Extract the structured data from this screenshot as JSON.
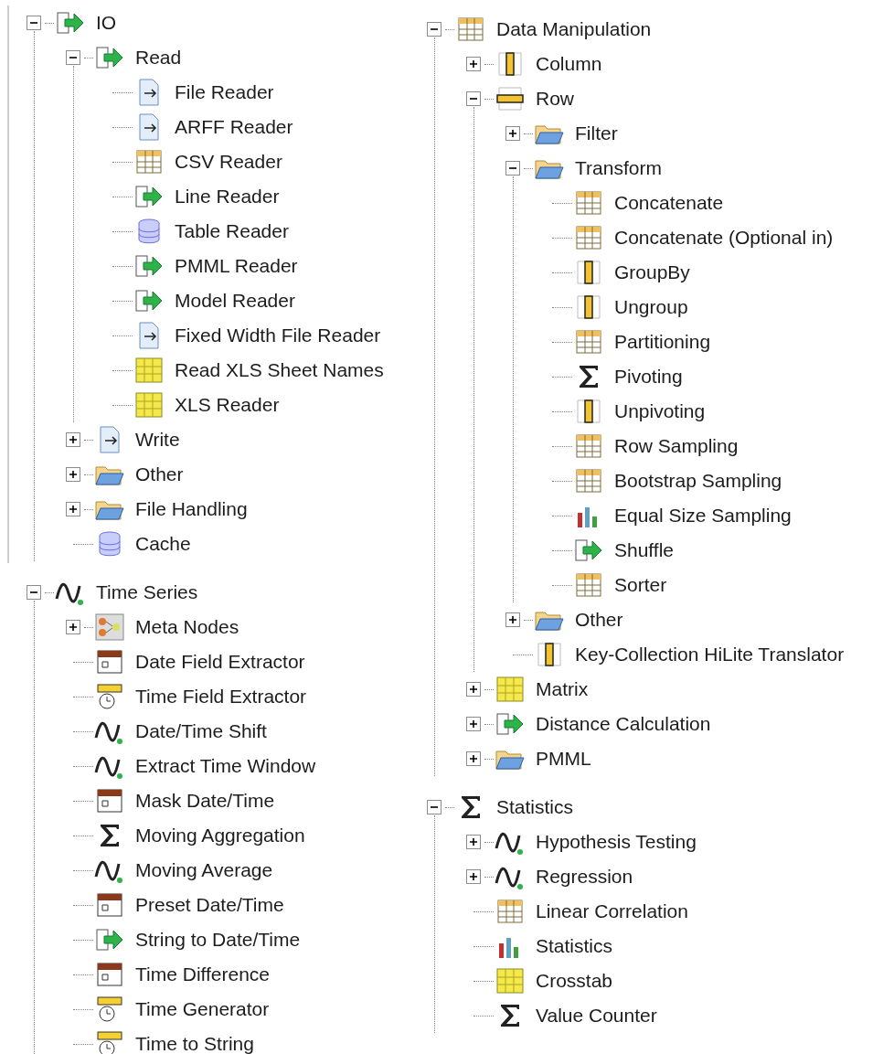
{
  "columns": [
    {
      "trees": [
        {
          "label": "IO",
          "kind": "arrow",
          "expanded": true,
          "children": [
            {
              "label": "Read",
              "kind": "arrow",
              "expanded": true,
              "children": [
                {
                  "label": "File Reader",
                  "kind": "document"
                },
                {
                  "label": "ARFF Reader",
                  "kind": "document"
                },
                {
                  "label": "CSV Reader",
                  "kind": "grid"
                },
                {
                  "label": "Line Reader",
                  "kind": "arrow"
                },
                {
                  "label": "Table Reader",
                  "kind": "database"
                },
                {
                  "label": "PMML Reader",
                  "kind": "arrow"
                },
                {
                  "label": "Model Reader",
                  "kind": "arrow"
                },
                {
                  "label": "Fixed Width File Reader",
                  "kind": "document"
                },
                {
                  "label": "Read XLS Sheet Names",
                  "kind": "spreadsheet"
                },
                {
                  "label": "XLS Reader",
                  "kind": "spreadsheet"
                }
              ]
            },
            {
              "label": "Write",
              "kind": "document",
              "expanded": false
            },
            {
              "label": "Other",
              "kind": "folder",
              "expanded": false
            },
            {
              "label": "File Handling",
              "kind": "folder",
              "expanded": false
            },
            {
              "label": "Cache",
              "kind": "database"
            }
          ]
        },
        {
          "label": "Time Series",
          "kind": "wave",
          "expanded": true,
          "children": [
            {
              "label": "Meta Nodes",
              "kind": "nodes",
              "expanded": false
            },
            {
              "label": "Date Field Extractor",
              "kind": "calendar"
            },
            {
              "label": "Time Field Extractor",
              "kind": "clock"
            },
            {
              "label": "Date/Time Shift",
              "kind": "wave"
            },
            {
              "label": "Extract Time Window",
              "kind": "wave"
            },
            {
              "label": "Mask Date/Time",
              "kind": "calendar"
            },
            {
              "label": "Moving Aggregation",
              "kind": "sigma"
            },
            {
              "label": "Moving Average",
              "kind": "wave"
            },
            {
              "label": "Preset Date/Time",
              "kind": "calendar"
            },
            {
              "label": "String to Date/Time",
              "kind": "arrow"
            },
            {
              "label": "Time Difference",
              "kind": "calendar"
            },
            {
              "label": "Time Generator",
              "kind": "clock"
            },
            {
              "label": "Time to String",
              "kind": "clock"
            }
          ]
        }
      ]
    },
    {
      "trees": [
        {
          "label": "Data Manipulation",
          "kind": "grid",
          "expanded": true,
          "children": [
            {
              "label": "Column",
              "kind": "column",
              "expanded": false
            },
            {
              "label": "Row",
              "kind": "row",
              "expanded": true,
              "children": [
                {
                  "label": "Filter",
                  "kind": "folder",
                  "expanded": false
                },
                {
                  "label": "Transform",
                  "kind": "folder",
                  "expanded": true,
                  "children": [
                    {
                      "label": "Concatenate",
                      "kind": "grid"
                    },
                    {
                      "label": "Concatenate (Optional in)",
                      "kind": "grid"
                    },
                    {
                      "label": "GroupBy",
                      "kind": "column"
                    },
                    {
                      "label": "Ungroup",
                      "kind": "column"
                    },
                    {
                      "label": "Partitioning",
                      "kind": "grid"
                    },
                    {
                      "label": "Pivoting",
                      "kind": "sigma"
                    },
                    {
                      "label": "Unpivoting",
                      "kind": "column"
                    },
                    {
                      "label": "Row Sampling",
                      "kind": "grid"
                    },
                    {
                      "label": "Bootstrap Sampling",
                      "kind": "grid"
                    },
                    {
                      "label": "Equal Size Sampling",
                      "kind": "bars"
                    },
                    {
                      "label": "Shuffle",
                      "kind": "arrow"
                    },
                    {
                      "label": "Sorter",
                      "kind": "grid"
                    }
                  ]
                },
                {
                  "label": "Other",
                  "kind": "folder",
                  "expanded": false
                },
                {
                  "label": "Key-Collection HiLite Translator",
                  "kind": "column"
                }
              ]
            },
            {
              "label": "Matrix",
              "kind": "spreadsheet",
              "expanded": false
            },
            {
              "label": "Distance Calculation",
              "kind": "arrow",
              "expanded": false
            },
            {
              "label": "PMML",
              "kind": "folder",
              "expanded": false
            }
          ]
        },
        {
          "label": "Statistics",
          "kind": "sigma",
          "expanded": true,
          "children": [
            {
              "label": "Hypothesis Testing",
              "kind": "wave",
              "expanded": false
            },
            {
              "label": "Regression",
              "kind": "wave",
              "expanded": false
            },
            {
              "label": "Linear Correlation",
              "kind": "grid"
            },
            {
              "label": "Statistics",
              "kind": "bars"
            },
            {
              "label": "Crosstab",
              "kind": "spreadsheet"
            },
            {
              "label": "Value Counter",
              "kind": "sigma"
            }
          ]
        }
      ]
    }
  ]
}
